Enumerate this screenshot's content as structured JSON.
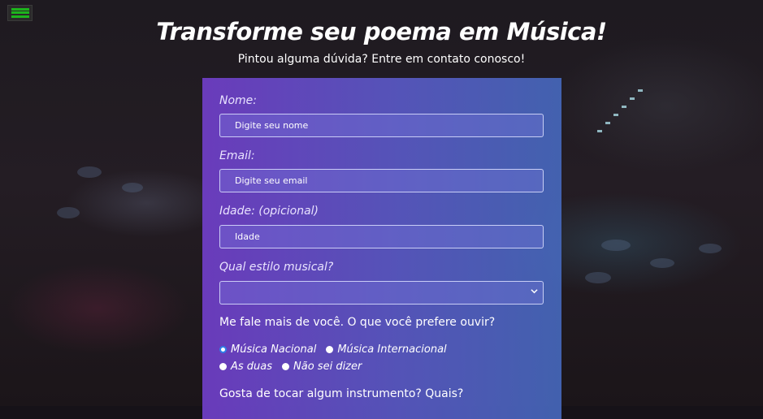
{
  "header": {
    "title": "Transforme seu poema em Música!",
    "subtitle": "Pintou alguma dúvida? Entre em contato conosco!"
  },
  "menu": {
    "icon": "hamburger-menu-icon",
    "icon_color": "#1db31d"
  },
  "form": {
    "name_label": "Nome:",
    "name_placeholder": "Digite seu nome",
    "email_label": "Email:",
    "email_placeholder": "Digite seu email",
    "age_label": "Idade: (opicional)",
    "age_placeholder": "Idade",
    "style_label": "Qual estilo musical?",
    "style_selected": "",
    "preference_question": "Me fale mais de você. O que você prefere ouvir?",
    "preference_options": [
      {
        "label": "Música Nacional",
        "selected": true
      },
      {
        "label": "Música Internacional",
        "selected": false
      },
      {
        "label": "As duas",
        "selected": false
      },
      {
        "label": "Não sei dizer",
        "selected": false
      }
    ],
    "instrument_question": "Gosta de tocar algum instrumento? Quais?"
  },
  "colors": {
    "card_gradient_start": "#703ec8",
    "card_gradient_end": "#4669be",
    "radio_selected_ring": "#2f7fe8"
  }
}
